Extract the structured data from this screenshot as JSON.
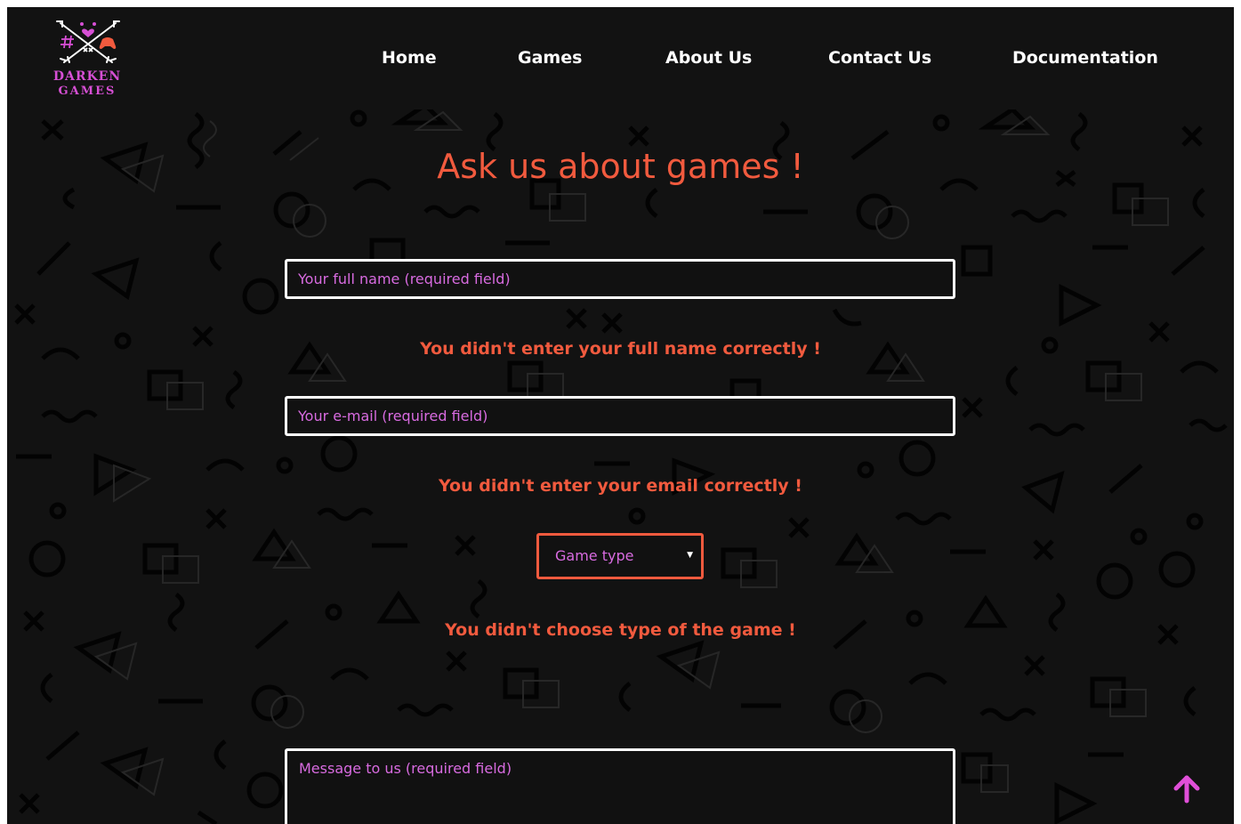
{
  "brand": {
    "line1": "DARKEN",
    "line2": "GAMES",
    "logo_icons": [
      "crossed-arrows-icon",
      "hash-icon",
      "gamepad-icon",
      "heart-icon"
    ]
  },
  "nav": {
    "items": [
      {
        "label": "Home"
      },
      {
        "label": "Games"
      },
      {
        "label": "About Us"
      },
      {
        "label": "Contact Us"
      },
      {
        "label": "Documentation"
      }
    ]
  },
  "form": {
    "title": "Ask us about games !",
    "name_placeholder": "Your full name (required field)",
    "name_error": "You didn't enter your full name correctly !",
    "email_placeholder": "Your e-mail (required field)",
    "email_error": "You didn't enter your email correctly !",
    "game_type_selected": "Game type",
    "game_type_error": "You didn't choose type of the game !",
    "message_placeholder": "Message to us (required field)"
  },
  "colors": {
    "background": "#121212",
    "accent_error": "#f15a3e",
    "placeholder": "#d86be0",
    "brand": "#d64fd4",
    "scroll_top": "#e04fd8"
  },
  "icons": {
    "scroll_top": "arrow-up-icon"
  }
}
